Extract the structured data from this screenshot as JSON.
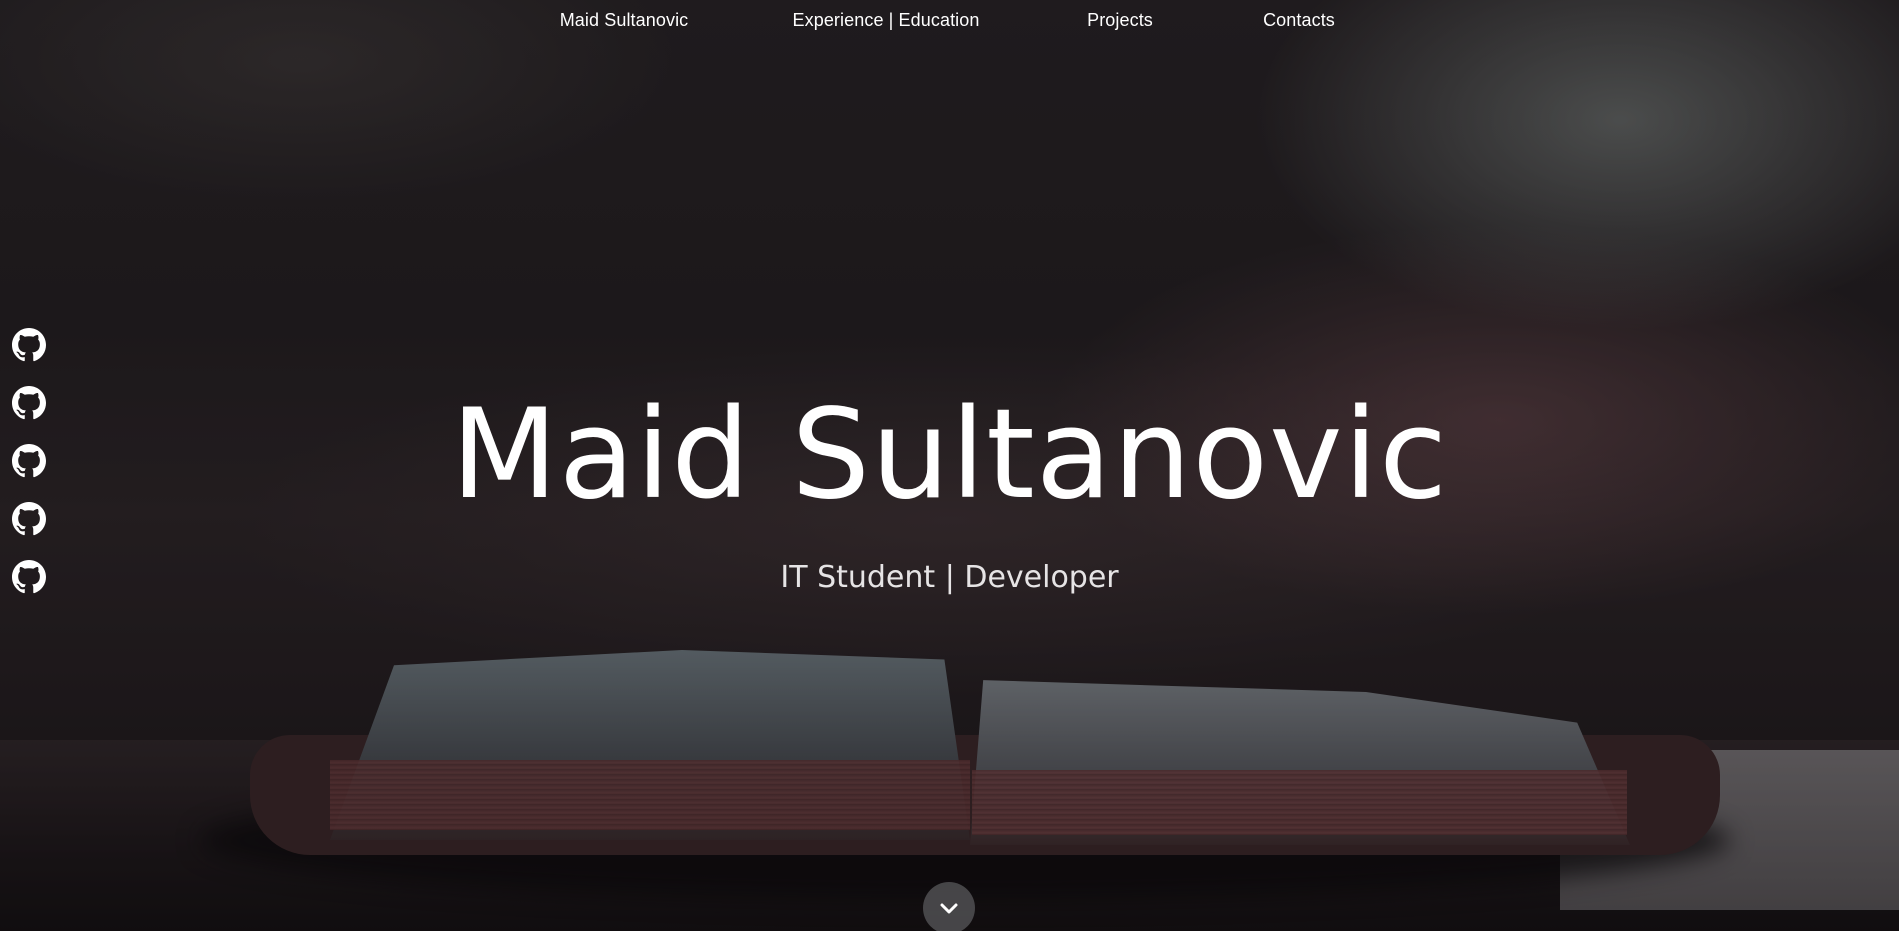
{
  "nav": {
    "items": [
      {
        "label": "Maid Sultanovic"
      },
      {
        "label": "Experience | Education"
      },
      {
        "label": "Projects"
      },
      {
        "label": "Contacts"
      }
    ]
  },
  "social": {
    "items": [
      {
        "icon": "github-icon"
      },
      {
        "icon": "github-icon"
      },
      {
        "icon": "github-icon"
      },
      {
        "icon": "github-icon"
      },
      {
        "icon": "github-icon"
      }
    ]
  },
  "hero": {
    "title": "Maid Sultanovic",
    "subtitle": "IT Student | Developer"
  },
  "scroll_button": {
    "icon": "chevron-down-icon"
  },
  "colors": {
    "text": "#ffffff",
    "scroll_button_bg": "#505052"
  }
}
